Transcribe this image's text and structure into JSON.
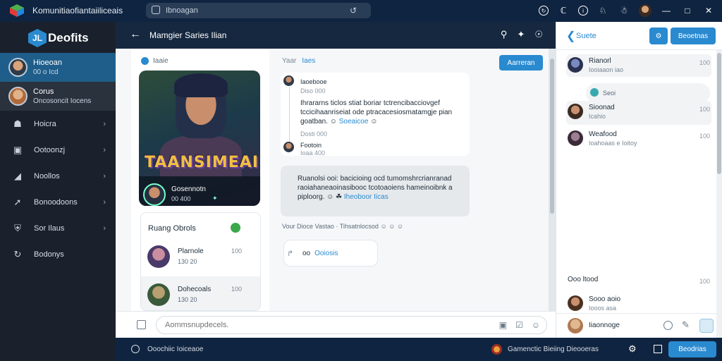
{
  "titlebar": {
    "title": "Komunitiaofiantaiiliceais",
    "search_text": "Ibnoagan",
    "icons": [
      "logo-icon",
      "refresh-icon",
      "history-icon",
      "tip-icon",
      "info-icon",
      "controller-icon",
      "bell-icon",
      "avatar",
      "minimize-icon",
      "maximize-icon",
      "close-icon"
    ]
  },
  "sidebar": {
    "brand": "Deofits",
    "brand_mark": "JL",
    "contacts": [
      {
        "name": "Hioeoan",
        "sub": "00 o Icd"
      },
      {
        "name": "Corus",
        "sub": "Oncosoncit Iocens"
      }
    ],
    "nav": [
      {
        "label": "Hoicra",
        "icon": "home-icon"
      },
      {
        "label": "Ootoonzj",
        "icon": "briefcase-icon"
      },
      {
        "label": "Noollos",
        "icon": "folder-icon"
      },
      {
        "label": "Bonoodoons",
        "icon": "rocket-icon"
      },
      {
        "label": "Sor Ilaus",
        "icon": "shield-icon"
      },
      {
        "label": "Bodonys",
        "icon": "refresh-icon"
      }
    ]
  },
  "mainhead": {
    "title": "Mamgier Saries Ilian"
  },
  "group": {
    "label": "Iaaie",
    "game_title": "TAANSIMEAI",
    "card_name": "Gosennotn",
    "card_sub": "00 400"
  },
  "players": {
    "title": "Ruang Obrols",
    "rows": [
      {
        "name": "Plarnole",
        "sub": "130  20",
        "value": "100"
      },
      {
        "name": "Dohecoals",
        "sub": "130  20",
        "value": "100"
      }
    ]
  },
  "chat": {
    "you": "Yaar",
    "you_hl": "Iaes",
    "accept": "Aarreran",
    "m1_name": "Iaoebooe",
    "m1_time": "Diso 000",
    "m1_text": "Ihrararns ticlos stiat boriar tctrencibacciovgef tccicihaanriseiat ode ptracacesiosmatamgje pian goatban.",
    "m1_link": "Soeaicoe",
    "m1_time2": "Dosti 000",
    "m2_name": "Footoin",
    "m2_time": "Ioaa 400",
    "m2_text": "Ruanolsi ooi: bacicioing ocd tumomshrcrianranad raoiahaneaoinasibooc tcotoaoiens hameinoibnk a piploorg.",
    "m2_link": "Iheoboor Iicas",
    "meta": "Vour  Dioce  Vastao  ·  Tihsatnlocsod",
    "reply": "Ooiosis",
    "reply_prefix": "oo"
  },
  "composer": {
    "placeholder": "Aommsnupdecels."
  },
  "bottombar": {
    "status": "Ooochiic Ioiceaoe",
    "game_status": "Gamenctic  Bieiing  Dieooeras",
    "button": "Beodrias"
  },
  "rpanel": {
    "title": "Suete",
    "btn_label": "Beoetnas",
    "rows": [
      {
        "name": "Rianorl",
        "sub": "Iooiaaon iao",
        "value": "100"
      },
      {
        "name": "Sioonad",
        "sub": "Icahio",
        "value": "100"
      },
      {
        "name": "Weafood",
        "sub": "Ioahoaas e Ioitoy",
        "value": "100"
      },
      {
        "name": "Ooo ltood",
        "sub": "",
        "value": "100"
      },
      {
        "name": "Sooo aoio",
        "sub": "Iooos asa",
        "value": ""
      }
    ],
    "chip": "Seoi",
    "foot_input": "Iiaonnoge"
  },
  "colors": {
    "accent": "#2a8ad0",
    "titlebar": "#0f2440",
    "sidebar": "#1a212c",
    "active": "#1f5e8a"
  }
}
